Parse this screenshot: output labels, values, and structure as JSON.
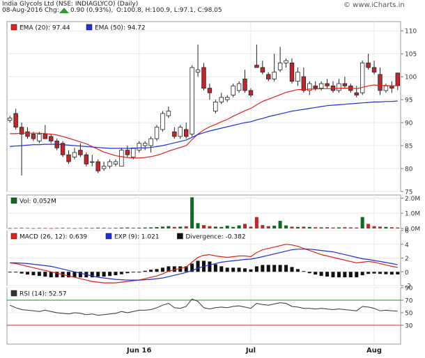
{
  "header": {
    "title": "India Glycols Ltd (NSE: INDIAGLYCO) (Daily)",
    "date": "08-Aug-2016",
    "chg_label": "Chg:",
    "change": "0.90 (0.93%),",
    "ohlc": "O:100.8, H:100.9, L:97.1, C:98.05",
    "watermark": "© www.iCharts.in"
  },
  "colors": {
    "up_fill": "#ffffff",
    "down_fill": "#c0262b",
    "candle_stroke": "#222222",
    "ema20": "#e0221b",
    "ema50": "#1f2fd6",
    "grid": "#e8e8e8",
    "volume": "#0b6b1e",
    "macd": "#e0221b",
    "signal": "#1f2fd6",
    "divergence": "#111111",
    "rsi": "#333333",
    "rsi_70_line": "#1f8f2e",
    "rsi_30_line": "#d9281e",
    "change_arrow": "#2e9b2e"
  },
  "chart_data": [
    {
      "type": "candlestick",
      "legend": [
        {
          "label": "EMA (20): 97.44",
          "color": "#e0221b"
        },
        {
          "label": "EMA (50): 94.72",
          "color": "#1f2fd6"
        }
      ],
      "ylim": [
        75,
        112
      ],
      "yticks": [
        "75",
        "80",
        "85",
        "90",
        "95",
        "100",
        "105",
        "110"
      ],
      "xlabels": [
        "Jun 16",
        "Jul",
        "Aug"
      ],
      "ohlc": [
        {
          "o": 90.5,
          "h": 91.5,
          "l": 90.0,
          "c": 91.0
        },
        {
          "o": 92.0,
          "h": 93.0,
          "l": 88.5,
          "c": 89.0
        },
        {
          "o": 89.0,
          "h": 90.0,
          "l": 78.5,
          "c": 87.5
        },
        {
          "o": 88.0,
          "h": 89.0,
          "l": 86.5,
          "c": 87.0
        },
        {
          "o": 87.5,
          "h": 88.0,
          "l": 86.0,
          "c": 86.5
        },
        {
          "o": 86.0,
          "h": 88.0,
          "l": 85.5,
          "c": 87.5
        },
        {
          "o": 87.5,
          "h": 89.5,
          "l": 86.5,
          "c": 86.5
        },
        {
          "o": 87.0,
          "h": 87.5,
          "l": 85.5,
          "c": 86.0
        },
        {
          "o": 86.0,
          "h": 86.5,
          "l": 84.0,
          "c": 84.5
        },
        {
          "o": 85.5,
          "h": 86.0,
          "l": 82.5,
          "c": 83.0
        },
        {
          "o": 83.0,
          "h": 84.0,
          "l": 81.0,
          "c": 81.5
        },
        {
          "o": 82.5,
          "h": 84.5,
          "l": 82.0,
          "c": 83.5
        },
        {
          "o": 84.0,
          "h": 85.5,
          "l": 82.5,
          "c": 83.0
        },
        {
          "o": 83.0,
          "h": 83.5,
          "l": 80.5,
          "c": 81.0
        },
        {
          "o": 81.5,
          "h": 83.0,
          "l": 80.5,
          "c": 81.5
        },
        {
          "o": 81.5,
          "h": 82.0,
          "l": 79.0,
          "c": 79.5
        },
        {
          "o": 80.0,
          "h": 81.5,
          "l": 79.5,
          "c": 80.5
        },
        {
          "o": 80.5,
          "h": 82.0,
          "l": 80.0,
          "c": 81.5
        },
        {
          "o": 81.0,
          "h": 82.0,
          "l": 80.5,
          "c": 81.5
        },
        {
          "o": 80.5,
          "h": 84.5,
          "l": 80.5,
          "c": 84.0
        },
        {
          "o": 84.0,
          "h": 85.0,
          "l": 82.5,
          "c": 83.0
        },
        {
          "o": 82.5,
          "h": 84.5,
          "l": 82.0,
          "c": 84.5
        },
        {
          "o": 84.0,
          "h": 86.0,
          "l": 83.5,
          "c": 85.5
        },
        {
          "o": 85.0,
          "h": 86.0,
          "l": 84.0,
          "c": 85.5
        },
        {
          "o": 85.0,
          "h": 87.0,
          "l": 83.5,
          "c": 86.5
        },
        {
          "o": 86.5,
          "h": 89.5,
          "l": 86.0,
          "c": 89.0
        },
        {
          "o": 88.5,
          "h": 92.5,
          "l": 88.0,
          "c": 92.0
        },
        {
          "o": 91.5,
          "h": 93.5,
          "l": 91.0,
          "c": 92.5
        },
        {
          "o": 88.0,
          "h": 89.0,
          "l": 86.5,
          "c": 87.0
        },
        {
          "o": 87.0,
          "h": 89.5,
          "l": 86.5,
          "c": 89.0
        },
        {
          "o": 88.5,
          "h": 90.0,
          "l": 86.5,
          "c": 87.0
        },
        {
          "o": 87.5,
          "h": 102.5,
          "l": 87.0,
          "c": 102.0
        },
        {
          "o": 101.0,
          "h": 107.0,
          "l": 100.0,
          "c": 101.5
        },
        {
          "o": 102.0,
          "h": 103.0,
          "l": 97.0,
          "c": 97.5
        },
        {
          "o": 97.5,
          "h": 98.5,
          "l": 95.0,
          "c": 96.5
        },
        {
          "o": 92.5,
          "h": 95.0,
          "l": 92.0,
          "c": 94.5
        },
        {
          "o": 94.5,
          "h": 96.5,
          "l": 94.0,
          "c": 95.5
        },
        {
          "o": 95.0,
          "h": 96.0,
          "l": 94.5,
          "c": 95.5
        },
        {
          "o": 96.0,
          "h": 98.5,
          "l": 95.5,
          "c": 98.0
        },
        {
          "o": 97.0,
          "h": 99.0,
          "l": 96.5,
          "c": 98.5
        },
        {
          "o": 99.5,
          "h": 101.5,
          "l": 96.5,
          "c": 97.0
        },
        {
          "o": 97.0,
          "h": 97.5,
          "l": 95.5,
          "c": 96.0
        },
        {
          "o": 102.5,
          "h": 107.0,
          "l": 102.0,
          "c": 102.0
        },
        {
          "o": 102.0,
          "h": 103.5,
          "l": 100.5,
          "c": 101.0
        },
        {
          "o": 100.5,
          "h": 101.0,
          "l": 99.0,
          "c": 99.5
        },
        {
          "o": 99.5,
          "h": 105.0,
          "l": 99.0,
          "c": 101.0
        },
        {
          "o": 101.5,
          "h": 106.5,
          "l": 101.0,
          "c": 103.0
        },
        {
          "o": 103.0,
          "h": 104.0,
          "l": 102.0,
          "c": 103.5
        },
        {
          "o": 103.0,
          "h": 104.0,
          "l": 98.5,
          "c": 99.0
        },
        {
          "o": 99.0,
          "h": 102.0,
          "l": 98.0,
          "c": 101.0
        },
        {
          "o": 100.0,
          "h": 102.0,
          "l": 96.5,
          "c": 97.0
        },
        {
          "o": 97.0,
          "h": 99.0,
          "l": 96.0,
          "c": 98.5
        },
        {
          "o": 98.0,
          "h": 99.0,
          "l": 97.0,
          "c": 97.5
        },
        {
          "o": 97.5,
          "h": 99.0,
          "l": 97.0,
          "c": 98.5
        },
        {
          "o": 98.5,
          "h": 99.5,
          "l": 97.5,
          "c": 98.0
        },
        {
          "o": 98.0,
          "h": 99.0,
          "l": 96.5,
          "c": 97.0
        },
        {
          "o": 97.0,
          "h": 99.5,
          "l": 96.5,
          "c": 98.5
        },
        {
          "o": 98.5,
          "h": 100.0,
          "l": 97.5,
          "c": 98.0
        },
        {
          "o": 98.0,
          "h": 98.5,
          "l": 96.5,
          "c": 97.0
        },
        {
          "o": 96.5,
          "h": 98.0,
          "l": 95.5,
          "c": 96.0
        },
        {
          "o": 96.5,
          "h": 103.5,
          "l": 96.0,
          "c": 103.0
        },
        {
          "o": 103.0,
          "h": 105.0,
          "l": 101.5,
          "c": 102.0
        },
        {
          "o": 102.0,
          "h": 103.5,
          "l": 100.5,
          "c": 101.0
        },
        {
          "o": 100.5,
          "h": 102.0,
          "l": 96.0,
          "c": 97.0
        },
        {
          "o": 97.0,
          "h": 98.5,
          "l": 96.5,
          "c": 98.0
        },
        {
          "o": 98.0,
          "h": 99.0,
          "l": 96.5,
          "c": 97.5
        },
        {
          "o": 100.8,
          "h": 100.9,
          "l": 97.1,
          "c": 98.05
        }
      ],
      "ema20": [
        87.6,
        87.6,
        87.7,
        87.7,
        87.7,
        87.7,
        87.6,
        87.5,
        87.3,
        87.0,
        86.6,
        86.2,
        85.8,
        85.4,
        84.8,
        84.2,
        83.6,
        83.2,
        82.8,
        82.6,
        82.4,
        82.3,
        82.3,
        82.4,
        82.6,
        82.9,
        83.3,
        83.8,
        84.2,
        84.6,
        85.0,
        86.3,
        87.5,
        88.4,
        89.1,
        89.6,
        90.2,
        90.7,
        91.4,
        92.0,
        92.6,
        93.1,
        93.9,
        94.6,
        95.1,
        95.6,
        96.1,
        96.6,
        96.9,
        97.2,
        97.2,
        97.3,
        97.3,
        97.4,
        97.4,
        97.4,
        97.5,
        97.5,
        97.5,
        97.4,
        97.7,
        98.0,
        98.2,
        98.1,
        98.1,
        98.0,
        98.05
      ],
      "ema50": [
        84.8,
        84.9,
        85.0,
        85.1,
        85.2,
        85.2,
        85.3,
        85.3,
        85.3,
        85.2,
        85.1,
        85.0,
        84.9,
        84.8,
        84.7,
        84.6,
        84.5,
        84.4,
        84.4,
        84.4,
        84.4,
        84.4,
        84.5,
        84.5,
        84.6,
        84.8,
        85.0,
        85.3,
        85.6,
        85.9,
        86.2,
        86.8,
        87.4,
        87.8,
        88.2,
        88.5,
        88.8,
        89.1,
        89.4,
        89.7,
        90.0,
        90.2,
        90.6,
        90.9,
        91.3,
        91.6,
        91.9,
        92.2,
        92.5,
        92.7,
        92.9,
        93.1,
        93.3,
        93.5,
        93.7,
        93.8,
        93.9,
        94.0,
        94.1,
        94.2,
        94.3,
        94.4,
        94.5,
        94.5,
        94.6,
        94.6,
        94.72
      ]
    },
    {
      "type": "bar",
      "legend": [
        {
          "label": "Vol: 0.052M",
          "color": "#0b6b1e"
        }
      ],
      "ylim": [
        0,
        2.2
      ],
      "yticks": [
        "0.0M",
        "1.0M",
        "2.0M"
      ],
      "values": [
        0.02,
        0.03,
        0.04,
        0.03,
        0.02,
        0.03,
        0.03,
        0.02,
        0.03,
        0.04,
        0.03,
        0.02,
        0.03,
        0.04,
        0.03,
        0.05,
        0.04,
        0.03,
        0.04,
        0.05,
        0.06,
        0.04,
        0.05,
        0.06,
        0.07,
        0.09,
        0.12,
        0.15,
        0.1,
        0.12,
        0.14,
        2.05,
        0.35,
        0.22,
        0.15,
        0.12,
        0.1,
        0.18,
        0.1,
        0.2,
        0.3,
        0.12,
        0.75,
        0.22,
        0.15,
        0.18,
        0.5,
        0.2,
        0.12,
        0.1,
        0.12,
        0.1,
        0.08,
        0.07,
        0.08,
        0.06,
        0.07,
        0.08,
        0.07,
        0.06,
        0.75,
        0.3,
        0.15,
        0.12,
        0.1,
        0.08,
        0.06
      ],
      "up": [
        true,
        false,
        false,
        false,
        false,
        true,
        false,
        false,
        false,
        false,
        false,
        true,
        false,
        false,
        true,
        false,
        true,
        true,
        true,
        true,
        false,
        true,
        true,
        true,
        true,
        true,
        true,
        true,
        false,
        true,
        false,
        true,
        true,
        false,
        false,
        true,
        true,
        true,
        true,
        true,
        false,
        false,
        false,
        false,
        false,
        true,
        true,
        true,
        false,
        true,
        false,
        true,
        false,
        true,
        false,
        false,
        true,
        false,
        false,
        false,
        true,
        false,
        false,
        false,
        true,
        false,
        false
      ]
    },
    {
      "type": "line",
      "legend": [
        {
          "label": "MACD (26, 12): 0.639",
          "color": "#e0221b"
        },
        {
          "label": "EXP (9): 1.021",
          "color": "#1f2fd6"
        },
        {
          "label": "Divergence: -0.382",
          "color": "#111111"
        }
      ],
      "ylim": [
        -2,
        6
      ],
      "yticks": [
        "-2",
        "0",
        "2",
        "4",
        "6"
      ],
      "macd": [
        1.3,
        1.2,
        1.0,
        0.8,
        0.6,
        0.4,
        0.2,
        0.0,
        -0.2,
        -0.4,
        -0.6,
        -0.8,
        -1.0,
        -1.2,
        -1.4,
        -1.5,
        -1.6,
        -1.6,
        -1.6,
        -1.5,
        -1.4,
        -1.3,
        -1.2,
        -1.0,
        -0.8,
        -0.6,
        -0.3,
        0.1,
        0.3,
        0.5,
        0.7,
        1.4,
        2.1,
        2.4,
        2.5,
        2.3,
        2.2,
        2.1,
        2.2,
        2.3,
        2.3,
        2.2,
        2.8,
        3.2,
        3.4,
        3.6,
        3.8,
        4.0,
        3.9,
        3.7,
        3.4,
        3.1,
        2.8,
        2.5,
        2.3,
        2.1,
        1.9,
        1.7,
        1.5,
        1.3,
        1.4,
        1.5,
        1.4,
        1.2,
        1.0,
        0.8,
        0.639
      ],
      "signal": [
        1.3,
        1.3,
        1.25,
        1.2,
        1.1,
        1.0,
        0.9,
        0.8,
        0.6,
        0.4,
        0.2,
        0.0,
        -0.2,
        -0.4,
        -0.6,
        -0.8,
        -0.9,
        -1.0,
        -1.1,
        -1.15,
        -1.2,
        -1.2,
        -1.2,
        -1.15,
        -1.1,
        -1.0,
        -0.9,
        -0.7,
        -0.5,
        -0.3,
        -0.1,
        0.2,
        0.5,
        0.8,
        1.0,
        1.2,
        1.4,
        1.5,
        1.6,
        1.7,
        1.8,
        1.85,
        2.0,
        2.2,
        2.4,
        2.6,
        2.8,
        3.0,
        3.2,
        3.3,
        3.3,
        3.3,
        3.2,
        3.1,
        3.0,
        2.9,
        2.7,
        2.5,
        2.3,
        2.1,
        1.9,
        1.8,
        1.65,
        1.5,
        1.35,
        1.2,
        1.021
      ],
      "divergence": [
        0,
        -0.1,
        -0.25,
        -0.4,
        -0.5,
        -0.6,
        -0.7,
        -0.8,
        -0.8,
        -0.8,
        -0.8,
        -0.8,
        -0.8,
        -0.8,
        -0.8,
        -0.7,
        -0.7,
        -0.6,
        -0.5,
        -0.35,
        -0.2,
        -0.1,
        0.0,
        0.15,
        0.3,
        0.4,
        0.6,
        0.8,
        0.8,
        0.8,
        0.8,
        1.2,
        1.6,
        1.6,
        1.5,
        1.1,
        0.8,
        0.6,
        0.6,
        0.6,
        0.5,
        0.35,
        0.8,
        1.0,
        1.0,
        1.0,
        1.0,
        1.0,
        0.7,
        0.4,
        0.1,
        -0.2,
        -0.4,
        -0.6,
        -0.7,
        -0.8,
        -0.8,
        -0.8,
        -0.8,
        -0.8,
        -0.5,
        -0.3,
        -0.25,
        -0.3,
        -0.35,
        -0.4,
        -0.382
      ]
    },
    {
      "type": "line",
      "legend": [
        {
          "label": "RSI (14): 52.57",
          "color": "#333333"
        }
      ],
      "ylim": [
        0,
        90
      ],
      "yticks": [
        "30",
        "50",
        "70",
        "90"
      ],
      "values": [
        62,
        58,
        55,
        54,
        53,
        52,
        54,
        52,
        50,
        49,
        48,
        50,
        49,
        47,
        48,
        46,
        47,
        48,
        49,
        52,
        50,
        52,
        54,
        54,
        55,
        58,
        62,
        65,
        58,
        57,
        60,
        72,
        68,
        58,
        56,
        58,
        59,
        58,
        60,
        61,
        59,
        57,
        65,
        63,
        62,
        64,
        66,
        65,
        60,
        59,
        57,
        57,
        56,
        57,
        56,
        55,
        56,
        55,
        54,
        53,
        60,
        59,
        57,
        53,
        54,
        53,
        52.57
      ]
    }
  ]
}
